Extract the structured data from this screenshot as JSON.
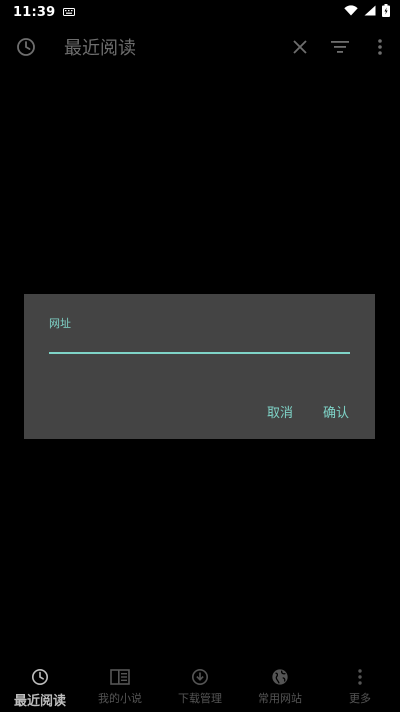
{
  "status_bar": {
    "time": "11:39"
  },
  "app_bar": {
    "title": "最近阅读",
    "icons": {
      "leading": "clock-icon",
      "clear": "close-icon",
      "filter": "filter-icon",
      "more": "more-vertical-icon"
    }
  },
  "dialog": {
    "field_label": "网址",
    "field_value": "",
    "cancel_label": "取消",
    "confirm_label": "确认",
    "accent_color": "#7fd4c8"
  },
  "bottom_nav": {
    "items": [
      {
        "label": "最近阅读",
        "icon": "clock-icon",
        "active": true
      },
      {
        "label": "我的小说",
        "icon": "book-icon",
        "active": false
      },
      {
        "label": "下载管理",
        "icon": "download-icon",
        "active": false
      },
      {
        "label": "常用网站",
        "icon": "globe-icon",
        "active": false
      },
      {
        "label": "更多",
        "icon": "more-vertical-icon",
        "active": false
      }
    ]
  }
}
